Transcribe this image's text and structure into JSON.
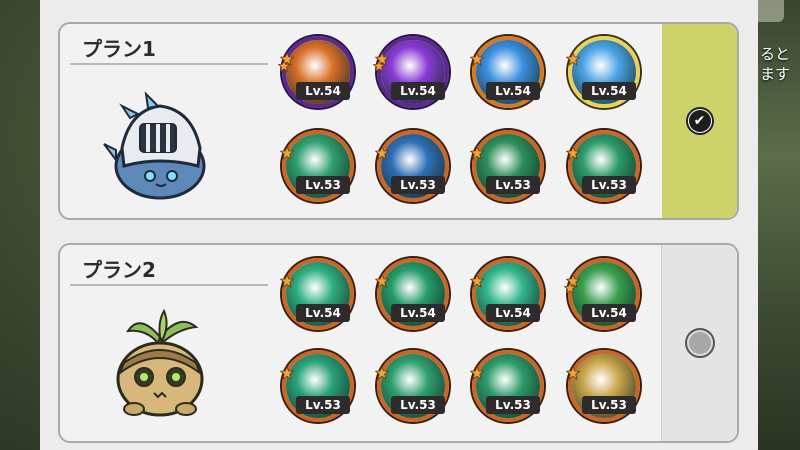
{
  "background": {
    "side_text": [
      "ると",
      "ます"
    ]
  },
  "plans": [
    {
      "title": "プラン1",
      "selected": true,
      "mascot": "knight-helmet-slime",
      "skills": [
        {
          "icon": "fire-phoenix-icon",
          "level": "Lv.54",
          "frame": "purple",
          "color": "#d9702a"
        },
        {
          "icon": "purple-eye-vortex-icon",
          "level": "Lv.54",
          "frame": "purple",
          "color": "#8a3bd6"
        },
        {
          "icon": "ice-shard-icon",
          "level": "Lv.54",
          "frame": "blue",
          "color": "#3b8fe0"
        },
        {
          "icon": "ice-burst-icon",
          "level": "Lv.54",
          "frame": "gold",
          "color": "#4aa3e6"
        },
        {
          "icon": "clover-emblem-icon",
          "level": "Lv.53",
          "frame": "orange",
          "color": "#2fa070"
        },
        {
          "icon": "wing-blade-icon",
          "level": "Lv.53",
          "frame": "orange",
          "color": "#2f6fb5"
        },
        {
          "icon": "star-wings-icon",
          "level": "Lv.53",
          "frame": "orange",
          "color": "#2d8f5a"
        },
        {
          "icon": "shield-wings-icon",
          "level": "Lv.53",
          "frame": "orange",
          "color": "#2d9b6a"
        }
      ]
    },
    {
      "title": "プラン2",
      "selected": false,
      "mascot": "sprout-seed-creature",
      "skills": [
        {
          "icon": "wind-slash-icon",
          "level": "Lv.54",
          "frame": "orange",
          "color": "#2fae80"
        },
        {
          "icon": "thorn-vine-icon",
          "level": "Lv.54",
          "frame": "orange",
          "color": "#249d6a"
        },
        {
          "icon": "tornado-icon",
          "level": "Lv.54",
          "frame": "orange",
          "color": "#33b58c"
        },
        {
          "icon": "leaf-storm-icon",
          "level": "Lv.54",
          "frame": "orange",
          "color": "#3aa04e"
        },
        {
          "icon": "figure-silhouette-icon",
          "level": "Lv.53",
          "frame": "orange",
          "color": "#2aa27a"
        },
        {
          "icon": "clover-emblem-icon",
          "level": "Lv.53",
          "frame": "orange",
          "color": "#2fa070"
        },
        {
          "icon": "shield-wings-icon",
          "level": "Lv.53",
          "frame": "orange",
          "color": "#2d9b6a"
        },
        {
          "icon": "holy-light-icon",
          "level": "Lv.53",
          "frame": "orange",
          "color": "#c9a54a"
        }
      ]
    }
  ]
}
